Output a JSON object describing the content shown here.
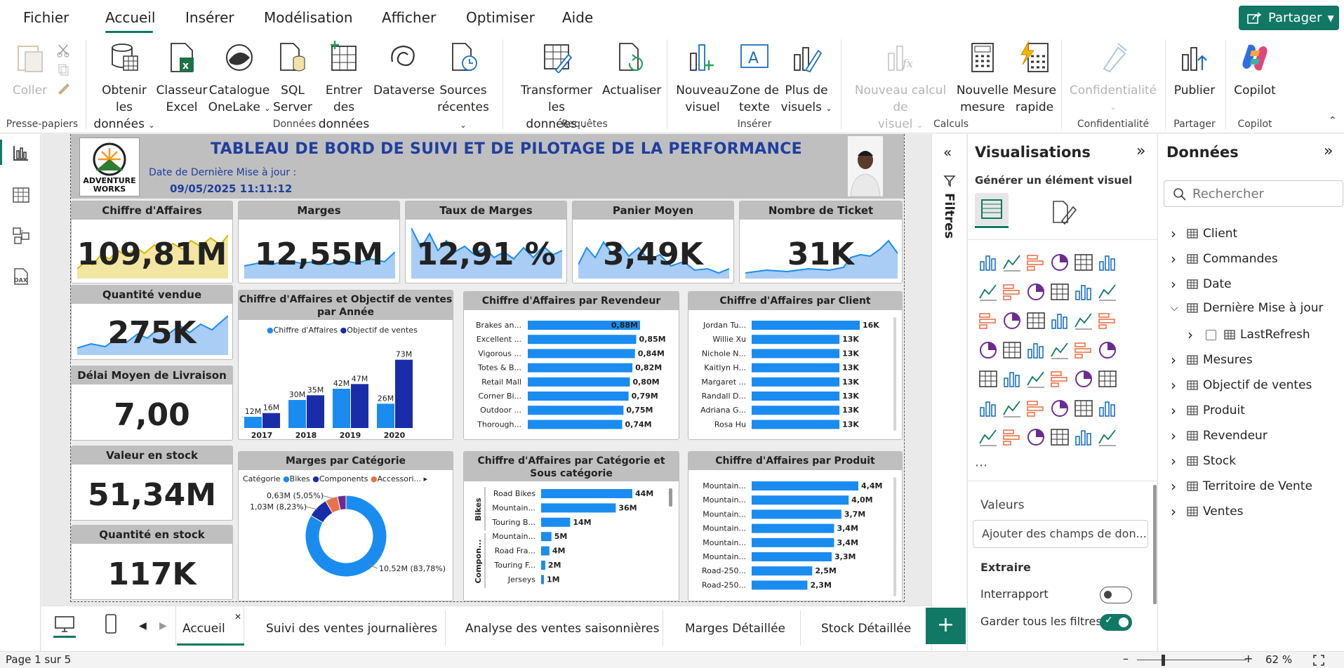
{
  "menu": {
    "file": "Fichier",
    "home": "Accueil",
    "insert": "Insérer",
    "modeling": "Modélisation",
    "view": "Afficher",
    "optimize": "Optimiser",
    "help": "Aide",
    "share": "Partager"
  },
  "ribbon": {
    "paste": "Coller",
    "get_data": [
      "Obtenir les",
      "données"
    ],
    "excel": [
      "Classeur",
      "Excel"
    ],
    "onelake": [
      "Catalogue",
      "OneLake"
    ],
    "sql": [
      "SQL",
      "Server"
    ],
    "enter_data": [
      "Entrer des",
      "données"
    ],
    "dataverse": "Dataverse",
    "recent": [
      "Sources",
      "récentes"
    ],
    "transform": [
      "Transformer les",
      "données"
    ],
    "refresh": "Actualiser",
    "new_visual": [
      "Nouveau",
      "visuel"
    ],
    "text_box": [
      "Zone de",
      "texte"
    ],
    "more_visuals": [
      "Plus de",
      "visuels"
    ],
    "new_calc": [
      "Nouveau calcul de",
      "visuel"
    ],
    "new_measure": [
      "Nouvelle",
      "mesure"
    ],
    "quick_measure": [
      "Mesure",
      "rapide"
    ],
    "sensitivity": "Confidentialité",
    "publish": "Publier",
    "copilot": "Copilot",
    "groups": {
      "clipboard": "Presse-papiers",
      "data": "Données",
      "queries": "Requêtes",
      "insert": "Insérer",
      "calc": "Calculs",
      "sensitivity": "Confidentialité",
      "share": "Partager",
      "copilot": "Copilot"
    }
  },
  "report": {
    "title": "TABLEAU DE BORD DE SUIVI ET DE PILOTAGE DE LA PERFORMANCE",
    "update_label": "Date de Dernière Mise à jour :",
    "update_value": "09/05/2025 11:11:12",
    "logo_text": [
      "ADVENTURE",
      "WORKS"
    ],
    "kpis": {
      "ca": {
        "title": "Chiffre d'Affaires",
        "value": "109,81M"
      },
      "marges": {
        "title": "Marges",
        "value": "12,55M"
      },
      "taux": {
        "title": "Taux de Marges",
        "value": "12,91 %"
      },
      "panier": {
        "title": "Panier Moyen",
        "value": "3,49K"
      },
      "tickets": {
        "title": "Nombre de Ticket",
        "value": "31K"
      },
      "qte": {
        "title": "Quantité vendue",
        "value": "275K"
      },
      "delai": {
        "title": "Délai Moyen de Livraison",
        "value": "7,00"
      },
      "stock_val": {
        "title": "Valeur en stock",
        "value": "51,34M"
      },
      "stock_qte": {
        "title": "Quantité en stock",
        "value": "117K"
      }
    }
  },
  "chart_data": [
    {
      "type": "bar",
      "title": "Chiffre d'Affaires et Objectif de ventes par Année",
      "categories": [
        "2017",
        "2018",
        "2019",
        "2020"
      ],
      "series": [
        {
          "name": "Chiffre d'Affaires",
          "values": [
            12,
            30,
            42,
            26
          ],
          "labels": [
            "12M",
            "30M",
            "42M",
            "26M"
          ]
        },
        {
          "name": "Objectif de ventes",
          "values": [
            16,
            35,
            47,
            73
          ],
          "labels": [
            "16M",
            "35M",
            "47M",
            "73M"
          ]
        }
      ],
      "ylim": [
        0,
        75
      ]
    },
    {
      "type": "bar",
      "title": "Chiffre d'Affaires par Revendeur",
      "categories": [
        "Brakes an...",
        "Excellent ...",
        "Vigorous ...",
        "Totes & B...",
        "Retail Mall",
        "Corner Bi...",
        "Outdoor ...",
        "Thorough..."
      ],
      "values": [
        0.88,
        0.85,
        0.84,
        0.82,
        0.8,
        0.79,
        0.75,
        0.74
      ],
      "labels": [
        "0,88M",
        "0,85M",
        "0,84M",
        "0,82M",
        "0,80M",
        "0,79M",
        "0,75M",
        "0,74M"
      ]
    },
    {
      "type": "bar",
      "title": "Chiffre d'Affaires par Client",
      "categories": [
        "Jordan Tu...",
        "Willie Xu",
        "Nichole N...",
        "Kaitlyn H...",
        "Margaret ...",
        "Randall D...",
        "Adriana G...",
        "Rosa Hu"
      ],
      "values": [
        16,
        13,
        13,
        13,
        13,
        13,
        13,
        13
      ],
      "labels": [
        "16K",
        "13K",
        "13K",
        "13K",
        "13K",
        "13K",
        "13K",
        "13K"
      ]
    },
    {
      "type": "pie",
      "title": "Marges par Catégorie",
      "legend_title": "Catégorie",
      "categories": [
        "Bikes",
        "Components",
        "Accessori..."
      ],
      "values": [
        10.52,
        1.03,
        0.63
      ],
      "labels": [
        "10,52M (83,78%)",
        "1,03M (8,23%)",
        "0,63M (5,05%)"
      ]
    },
    {
      "type": "bar",
      "title": "Chiffre d'Affaires par Catégorie et Sous catégorie",
      "groups": [
        "Bikes",
        "Compon..."
      ],
      "categories": [
        "Road Bikes",
        "Mountain...",
        "Touring B...",
        "Mountain...",
        "Road Fra...",
        "Touring F...",
        "Jerseys"
      ],
      "values": [
        44,
        36,
        14,
        5,
        4,
        2,
        1
      ],
      "labels": [
        "44M",
        "36M",
        "14M",
        "5M",
        "4M",
        "2M",
        "1M"
      ]
    },
    {
      "type": "bar",
      "title": "Chiffre d'Affaires par Produit",
      "categories": [
        "Mountain...",
        "Mountain...",
        "Mountain...",
        "Mountain...",
        "Mountain...",
        "Mountain...",
        "Road-250...",
        "Road-250..."
      ],
      "values": [
        4.4,
        4.0,
        3.7,
        3.4,
        3.4,
        3.3,
        2.5,
        2.3
      ],
      "labels": [
        "4,4M",
        "4,0M",
        "3,7M",
        "3,4M",
        "3,4M",
        "3,3M",
        "2,5M",
        "2,3M"
      ]
    }
  ],
  "filters": {
    "label": "Filtres"
  },
  "viz": {
    "title": "Visualisations",
    "subtitle": "Générer un élément visuel",
    "values_label": "Valeurs",
    "add_fields": "Ajouter des champs de don...",
    "drillthrough": "Extraire",
    "cross_report": "Interrapport",
    "keep_filters": "Garder tous les filtres"
  },
  "data_pane": {
    "title": "Données",
    "search_placeholder": "Rechercher",
    "tables": [
      "Client",
      "Commandes",
      "Date",
      "Dernière Mise à jour",
      "LastRefresh",
      "Mesures",
      "Objectif de ventes",
      "Produit",
      "Revendeur",
      "Stock",
      "Territoire de Vente",
      "Ventes"
    ]
  },
  "tabs": [
    "Accueil",
    "Suivi des ventes journalières",
    "Analyse des ventes saisonnières",
    "Marges Détaillée",
    "Stock Détaillée"
  ],
  "status": {
    "page": "Page 1 sur 5",
    "zoom": "62 %"
  },
  "colors": {
    "accent": "#117865",
    "bar": "#1a8cf0",
    "bar_dark": "#1a2da8",
    "title": "#1f3f9f",
    "accessories": "#e8734a",
    "other": "#6b2c91"
  }
}
